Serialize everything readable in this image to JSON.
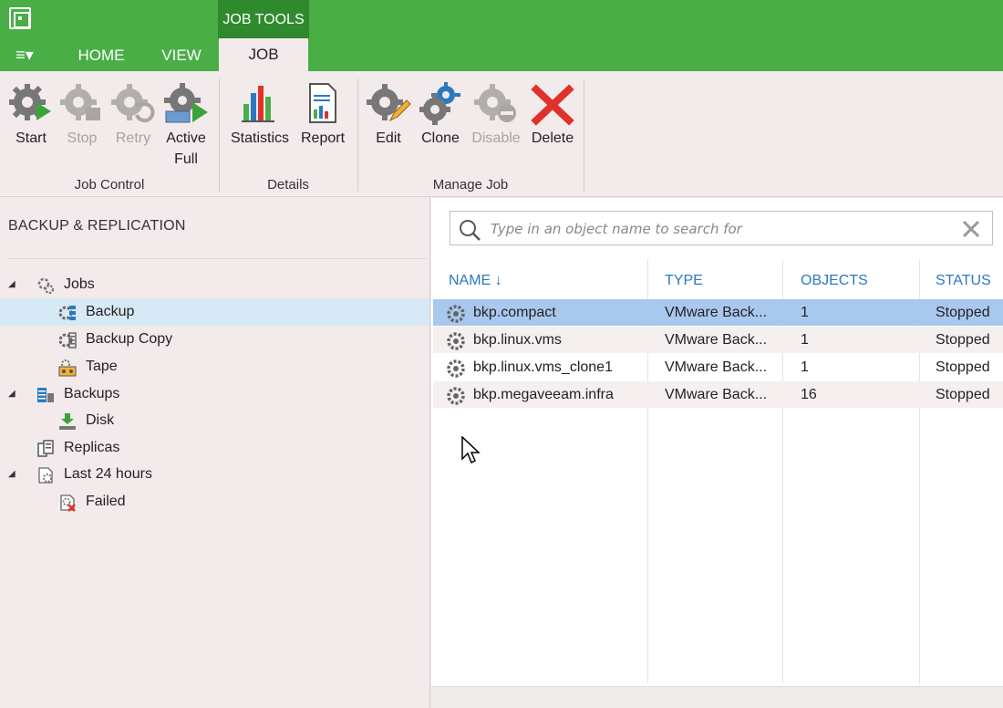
{
  "ribbon_context_tab": "JOB TOOLS",
  "tabs": {
    "menu": "≡▾",
    "home": "HOME",
    "view": "VIEW",
    "job": "JOB"
  },
  "ribbon": {
    "job_control": {
      "label": "Job Control",
      "start": "Start",
      "stop": "Stop",
      "retry": "Retry",
      "active_full_line1": "Active",
      "active_full_line2": "Full"
    },
    "details": {
      "label": "Details",
      "statistics": "Statistics",
      "report": "Report"
    },
    "manage_job": {
      "label": "Manage Job",
      "edit": "Edit",
      "clone": "Clone",
      "disable": "Disable",
      "delete": "Delete"
    }
  },
  "nav": {
    "title": "BACKUP & REPLICATION",
    "items": [
      {
        "label": "Jobs",
        "icon": "jobs-icon"
      },
      {
        "label": "Backup",
        "icon": "backup-job-icon"
      },
      {
        "label": "Backup Copy",
        "icon": "backup-copy-icon"
      },
      {
        "label": "Tape",
        "icon": "tape-icon"
      },
      {
        "label": "Backups",
        "icon": "backups-icon"
      },
      {
        "label": "Disk",
        "icon": "disk-icon"
      },
      {
        "label": "Replicas",
        "icon": "replicas-icon"
      },
      {
        "label": "Last 24 hours",
        "icon": "last-24-hours-icon"
      },
      {
        "label": "Failed",
        "icon": "failed-icon"
      }
    ]
  },
  "search": {
    "placeholder": "Type in an object name to search for"
  },
  "grid": {
    "columns": [
      "NAME",
      "TYPE",
      "OBJECTS",
      "STATUS"
    ],
    "sort_indicator": "↓",
    "rows": [
      {
        "name": "bkp.compact",
        "type": "VMware Back...",
        "objects": "1",
        "status": "Stopped"
      },
      {
        "name": "bkp.linux.vms",
        "type": "VMware Back...",
        "objects": "1",
        "status": "Stopped"
      },
      {
        "name": "bkp.linux.vms_clone1",
        "type": "VMware Back...",
        "objects": "1",
        "status": "Stopped"
      },
      {
        "name": "bkp.megaveeam.infra",
        "type": "VMware Back...",
        "objects": "16",
        "status": "Stopped"
      }
    ]
  },
  "colors": {
    "brand_green": "#4aae47",
    "context_tab_green": "#2f8a2d",
    "selection_blue": "#a9c8ee",
    "nav_selection": "#d7e9f4",
    "column_header_blue": "#2a7ac0",
    "delete_red": "#e0312a"
  }
}
